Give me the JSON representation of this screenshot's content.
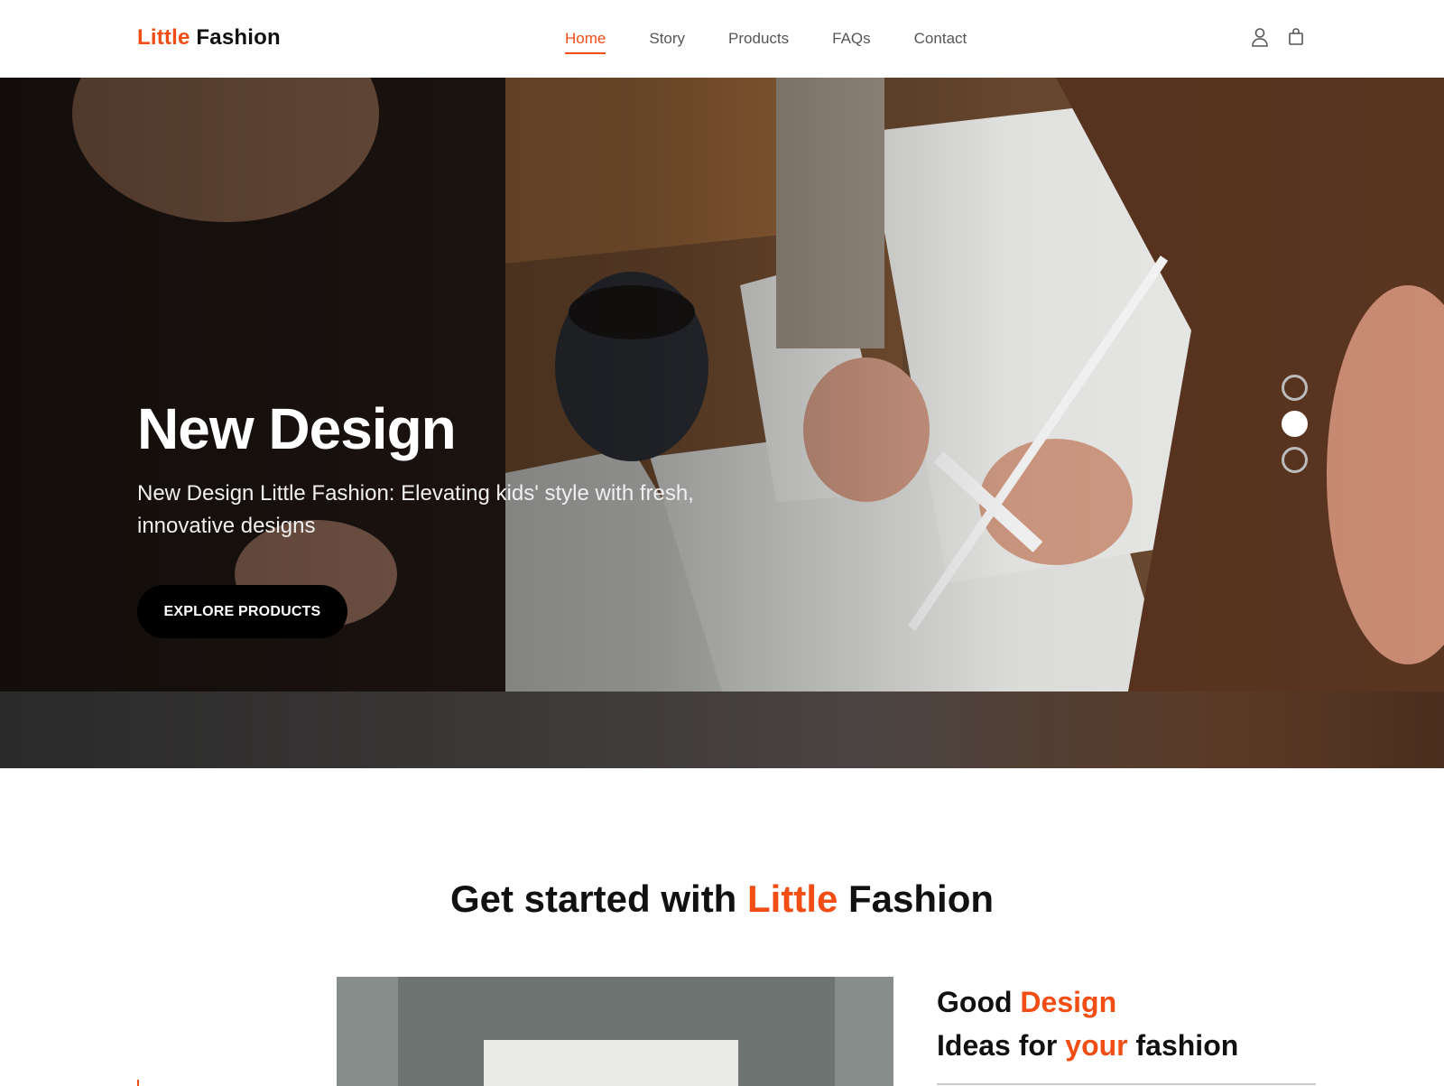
{
  "brand": {
    "accent": "Little",
    "rest": "Fashion"
  },
  "nav": {
    "links": [
      {
        "label": "Home",
        "active": true
      },
      {
        "label": "Story"
      },
      {
        "label": "Products"
      },
      {
        "label": "FAQs"
      },
      {
        "label": "Contact"
      }
    ],
    "icons": [
      "user-icon",
      "shopping-bag-icon"
    ]
  },
  "hero": {
    "title": "New Design",
    "text": "New Design Little Fashion: Elevating kids' style with fresh, innovative designs",
    "button_label": "EXPLORE PRODUCTS",
    "slides": 3,
    "active_slide": 2
  },
  "section": {
    "title_pre": "Get started with",
    "title_accent": "Little",
    "title_post": "Fashion"
  },
  "feature": {
    "line1_pre": "Good",
    "line1_accent": "Design",
    "line2_pre": "Ideas for",
    "line2_accent": "your",
    "line2_post": "fashion"
  },
  "colors": {
    "accent": "#f14d14",
    "dark": "#111111",
    "button": "#000000"
  }
}
